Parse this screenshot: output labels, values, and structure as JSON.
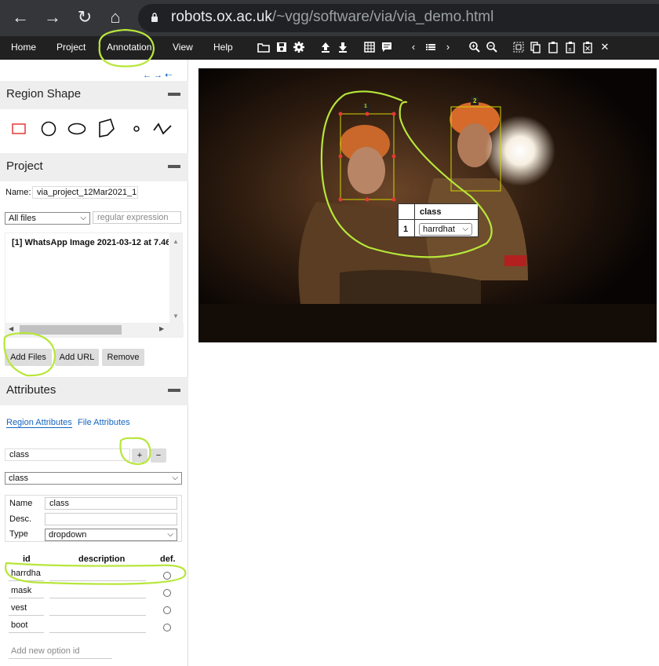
{
  "browser": {
    "url_host": "robots.ox.ac.uk",
    "url_path": "/~vgg/software/via/via_demo.html"
  },
  "menu": {
    "items": [
      "Home",
      "Project",
      "Annotation",
      "View",
      "Help"
    ]
  },
  "toolbar": {
    "icons": [
      "folder-open",
      "save",
      "settings",
      "upload",
      "download",
      "grid",
      "comment",
      "prev",
      "list",
      "next",
      "zoom-in",
      "zoom-out",
      "select-all",
      "copy",
      "paste",
      "paste-n",
      "paste-delete",
      "close"
    ]
  },
  "mini_nav": "← → ⇠",
  "region_shape": {
    "title": "Region Shape",
    "shapes": [
      "rectangle",
      "circle",
      "ellipse",
      "polygon",
      "point",
      "polyline"
    ]
  },
  "project": {
    "title": "Project",
    "name_label": "Name:",
    "name_value": "via_project_12Mar2021_1",
    "filter_value": "All files",
    "regex_placeholder": "regular expression",
    "files": [
      "[1] WhatsApp Image 2021-03-12 at 7.46"
    ],
    "add_files": "Add Files",
    "add_url": "Add URL",
    "remove": "Remove"
  },
  "attributes": {
    "title": "Attributes",
    "tab_region": "Region Attributes",
    "tab_file": "File Attributes",
    "new_attr_value": "class",
    "add_btn": "+",
    "remove_btn": "−",
    "selected_attr": "class",
    "name_label": "Name",
    "name_value": "class",
    "desc_label": "Desc.",
    "desc_value": "",
    "type_label": "Type",
    "type_value": "dropdown",
    "col_id": "id",
    "col_description": "description",
    "col_def": "def.",
    "options": [
      "harrdha",
      "mask",
      "vest",
      "boot"
    ],
    "new_option_placeholder": "Add new option id"
  },
  "canvas": {
    "regions": [
      {
        "label": "1",
        "color": "#d4d400"
      },
      {
        "label": "2",
        "color": "#d4d400"
      }
    ],
    "popup": {
      "header": "class",
      "row_id": "1",
      "value": "harrdhat"
    }
  },
  "colors": {
    "menubar": "#212121",
    "chrome": "#35363a",
    "highlight": "#b7e63a",
    "region": "#d4d400"
  }
}
